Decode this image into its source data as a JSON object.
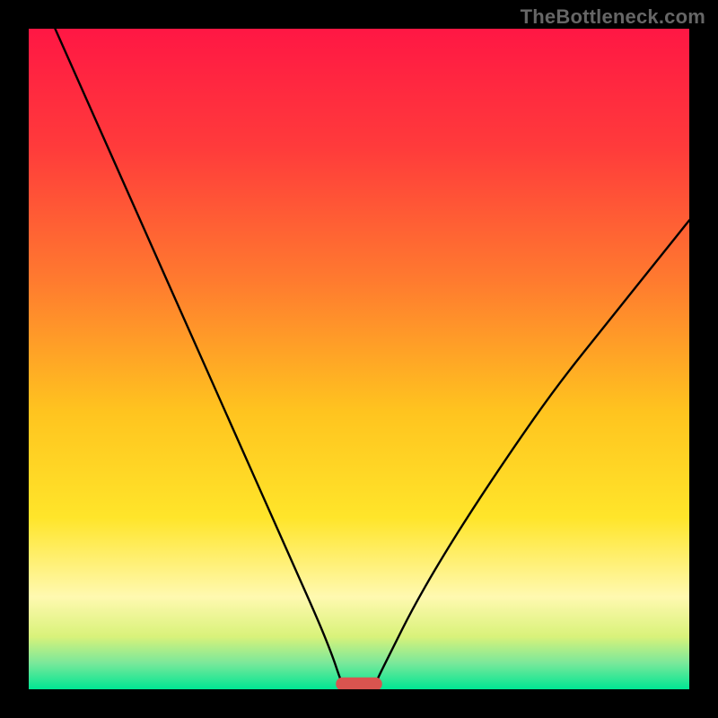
{
  "watermark": "TheBottleneck.com",
  "chart_data": {
    "type": "line",
    "title": "",
    "xlabel": "",
    "ylabel": "",
    "xlim": [
      0,
      100
    ],
    "ylim": [
      0,
      100
    ],
    "background_gradient_stops": [
      {
        "offset": 0.0,
        "color": "#ff1744"
      },
      {
        "offset": 0.18,
        "color": "#ff3b3b"
      },
      {
        "offset": 0.38,
        "color": "#ff7a2f"
      },
      {
        "offset": 0.58,
        "color": "#ffc41f"
      },
      {
        "offset": 0.74,
        "color": "#ffe52a"
      },
      {
        "offset": 0.86,
        "color": "#fff9b0"
      },
      {
        "offset": 0.92,
        "color": "#d9f27a"
      },
      {
        "offset": 0.96,
        "color": "#7be89a"
      },
      {
        "offset": 1.0,
        "color": "#00e693"
      }
    ],
    "series": [
      {
        "name": "left-curve",
        "x": [
          4,
          8,
          12,
          16,
          20,
          24,
          28,
          32,
          36,
          40,
          44,
          46,
          47,
          47.5
        ],
        "y": [
          100,
          91,
          82,
          73,
          64,
          55,
          46,
          37,
          28,
          19,
          10,
          5,
          2,
          0.8
        ]
      },
      {
        "name": "right-curve",
        "x": [
          52.5,
          53,
          55,
          58,
          62,
          67,
          73,
          80,
          88,
          96,
          100
        ],
        "y": [
          0.8,
          2,
          6,
          12,
          19,
          27,
          36,
          46,
          56,
          66,
          71
        ]
      }
    ],
    "marker": {
      "shape": "rounded-rect",
      "x_center": 50,
      "y_center": 0.8,
      "width": 7,
      "height": 2,
      "color": "#d9544f"
    }
  }
}
